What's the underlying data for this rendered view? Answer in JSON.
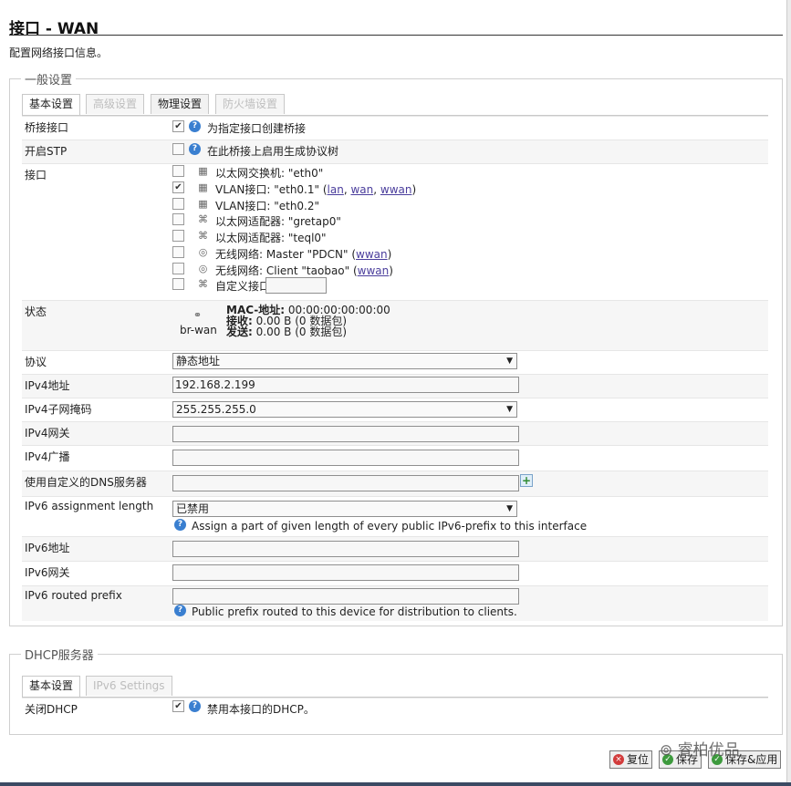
{
  "header": {
    "title": "接口 - WAN",
    "description": "配置网络接口信息。"
  },
  "general": {
    "legend": "一般设置",
    "tabs": [
      {
        "label": "基本设置",
        "state": "active"
      },
      {
        "label": "高级设置",
        "state": "disabled"
      },
      {
        "label": "物理设置",
        "state": "normal"
      },
      {
        "label": "防火墙设置",
        "state": "disabled"
      }
    ],
    "bridge": {
      "label": "桥接接口",
      "checked": true,
      "text": "为指定接口创建桥接"
    },
    "stp": {
      "label": "开启STP",
      "checked": false,
      "text": "在此桥接上启用生成协议树"
    },
    "iface": {
      "label": "接口",
      "items": [
        {
          "checked": false,
          "text": "以太网交换机: \"eth0\"",
          "icon": "switch-icon"
        },
        {
          "checked": true,
          "text": "VLAN接口: \"eth0.1\" (",
          "links": [
            "lan",
            "wan",
            "wwan"
          ],
          "icon": "switch-icon"
        },
        {
          "checked": false,
          "text": "VLAN接口: \"eth0.2\"",
          "icon": "switch-icon"
        },
        {
          "checked": false,
          "text": "以太网适配器: \"gretap0\"",
          "icon": "ethernet-icon"
        },
        {
          "checked": false,
          "text": "以太网适配器: \"teql0\"",
          "icon": "ethernet-icon"
        },
        {
          "checked": false,
          "text": "无线网络: Master \"PDCN\" (",
          "links": [
            "wwan"
          ],
          "icon": "wifi-icon"
        },
        {
          "checked": false,
          "text": "无线网络: Client \"taobao\" (",
          "links": [
            "wwan"
          ],
          "icon": "wifi-icon"
        },
        {
          "checked": false,
          "text": "自定义接口:",
          "icon": "ethernet-icon",
          "custom_value": ""
        }
      ]
    },
    "status": {
      "label": "状态",
      "device": "br-wan",
      "mac_label": "MAC-地址:",
      "mac": "00:00:00:00:00:00",
      "rx_label": "接收:",
      "rx": "0.00 B (0 数据包)",
      "tx_label": "发送:",
      "tx": "0.00 B (0 数据包)"
    },
    "protocol": {
      "label": "协议",
      "value": "静态地址"
    },
    "ipv4addr": {
      "label": "IPv4地址",
      "value": "192.168.2.199"
    },
    "netmask": {
      "label": "IPv4子网掩码",
      "value": "255.255.255.0"
    },
    "gateway": {
      "label": "IPv4网关",
      "value": ""
    },
    "broadcast": {
      "label": "IPv4广播",
      "value": ""
    },
    "dns": {
      "label": "使用自定义的DNS服务器",
      "value": ""
    },
    "ip6assign": {
      "label": "IPv6 assignment length",
      "value": "已禁用",
      "help": "Assign a part of given length of every public IPv6-prefix to this interface"
    },
    "ip6addr": {
      "label": "IPv6地址",
      "value": ""
    },
    "ip6gw": {
      "label": "IPv6网关",
      "value": ""
    },
    "ip6prefix": {
      "label": "IPv6 routed prefix",
      "value": "",
      "help": "Public prefix routed to this device for distribution to clients."
    }
  },
  "dhcp": {
    "legend": "DHCP服务器",
    "tabs": [
      {
        "label": "基本设置",
        "state": "active"
      },
      {
        "label": "IPv6 Settings",
        "state": "disabled"
      }
    ],
    "ignore": {
      "label": "关闭DHCP",
      "checked": true,
      "text": "禁用本接口的DHCP。"
    }
  },
  "footer": {
    "reset_label": "复位",
    "save_label": "保存",
    "apply_label": "保存&应用"
  },
  "watermark": "睿柏优品",
  "colors": {
    "link": "#4a3d9c",
    "help_icon": "#3a7fd0",
    "tab_border": "#c8c8c8"
  }
}
